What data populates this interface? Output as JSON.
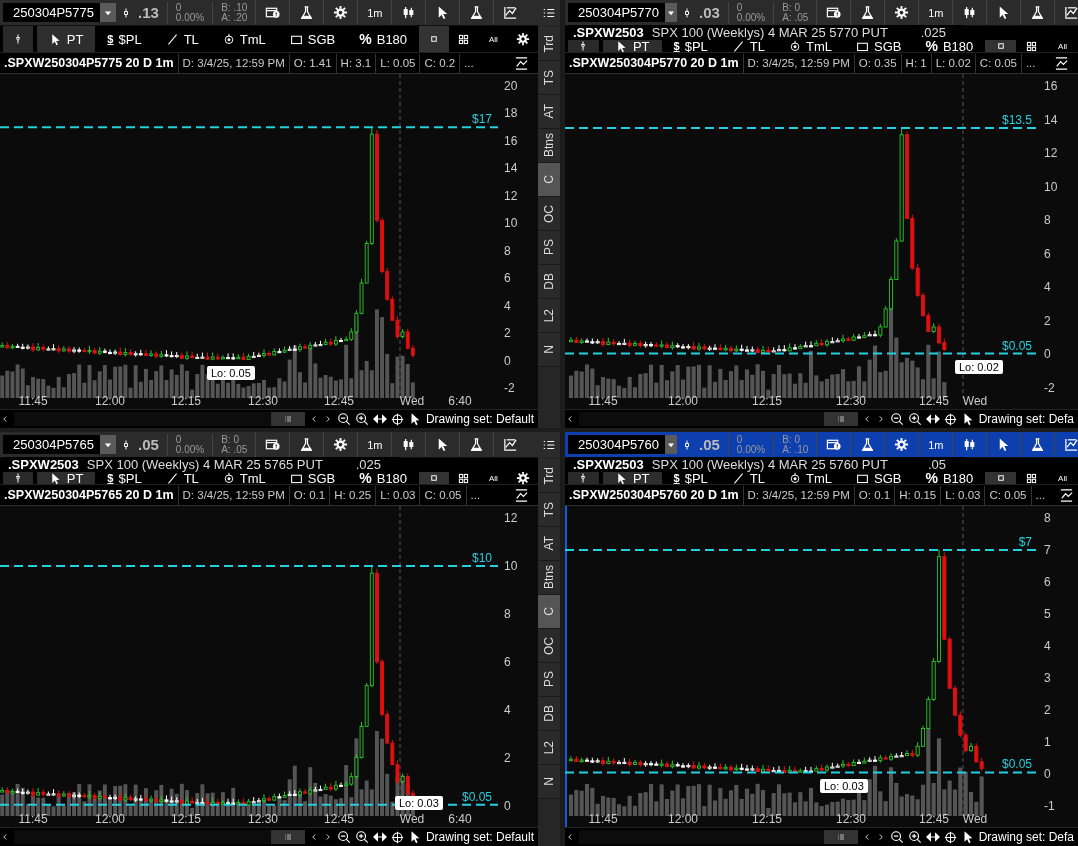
{
  "panels": [
    {
      "active": false,
      "symbol": "250304P5775",
      "last": ".13",
      "change": "0",
      "change_pct": "0.00%",
      "bid": "B: .10",
      "ask": "A: .20",
      "interval": "1m",
      "tools": [
        {
          "kind": "cursor",
          "label": "PT",
          "selected": true
        },
        {
          "kind": "dollar",
          "glyph": "$",
          "label": "$PL",
          "selected": false
        },
        {
          "kind": "line",
          "label": "TL",
          "selected": false
        },
        {
          "kind": "target",
          "label": "TmL",
          "selected": false
        },
        {
          "kind": "rect",
          "label": "SGB",
          "selected": false
        },
        {
          "kind": "percent",
          "glyph": "%",
          "label": "B180",
          "selected": false
        }
      ],
      "views": [
        {
          "kind": "single",
          "selected": true
        },
        {
          "kind": "grid",
          "selected": false
        },
        {
          "kind": "all",
          "label": "All",
          "selected": false
        },
        {
          "kind": "settings",
          "selected": false
        }
      ],
      "info": {
        "title": ".SPXW250304P5775 20 D 1m",
        "fields": [
          "D: 3/4/25, 12:59 PM",
          "O: 1.41",
          "H: 3.1",
          "L: 0.05",
          "C: 0.2",
          "..."
        ]
      },
      "y_ticks": [
        "20",
        "18",
        "16",
        "14",
        "12",
        "10",
        "8",
        "6",
        "4",
        "2",
        "0",
        "-2"
      ],
      "price_lines": [
        {
          "label": "$17"
        }
      ],
      "low_tag": "Lo: 0.05",
      "x_labels": [
        "11:45",
        "12:00",
        "12:15",
        "12:30",
        "12:45",
        "Wed",
        "6:40"
      ],
      "drawing_set": "Drawing set: Default"
    },
    {
      "active": false,
      "symbol": "250304P5770",
      "last": ".03",
      "change": "0",
      "change_pct": "0.00%",
      "bid": "B: 0",
      "ask": "A: .05",
      "interval": "1m",
      "tooltip": {
        "symbol": ".SPXW2503",
        "description": "SPX 100 (Weeklys) 4 MAR 25 5770 PUT",
        "value": ".025"
      },
      "tools": [
        {
          "kind": "cursor",
          "label": "PT",
          "selected": true
        },
        {
          "kind": "dollar",
          "glyph": "$",
          "label": "$PL",
          "selected": false
        },
        {
          "kind": "line",
          "label": "TL",
          "selected": false
        },
        {
          "kind": "target",
          "label": "TmL",
          "selected": false
        },
        {
          "kind": "rect",
          "label": "SGB",
          "selected": false
        },
        {
          "kind": "percent",
          "glyph": "%",
          "label": "B180",
          "selected": false
        }
      ],
      "views": [
        {
          "kind": "single",
          "selected": true
        },
        {
          "kind": "grid",
          "selected": false
        },
        {
          "kind": "all",
          "label": "All",
          "selected": false
        }
      ],
      "info": {
        "title": ".SPXW250304P5770 20 D 1m",
        "fields": [
          "D: 3/4/25, 12:59 PM",
          "O: 0.35",
          "H: 1",
          "L: 0.02",
          "C: 0.05",
          "..."
        ]
      },
      "y_ticks": [
        "16",
        "14",
        "12",
        "10",
        "8",
        "6",
        "4",
        "2",
        "0",
        "-2"
      ],
      "price_lines": [
        {
          "label": "$13.5"
        },
        {
          "label": "$0.05"
        }
      ],
      "low_tag": "Lo: 0.02",
      "x_labels": [
        "11:45",
        "12:00",
        "12:15",
        "12:30",
        "12:45",
        "Wed"
      ],
      "drawing_set": "Drawing set: Defa"
    },
    {
      "active": false,
      "symbol": "250304P5765",
      "last": ".05",
      "change": "0",
      "change_pct": "0.00%",
      "bid": "B: 0",
      "ask": "A: .05",
      "interval": "1m",
      "tooltip": {
        "symbol": ".SPXW2503",
        "description": "SPX 100 (Weeklys) 4 MAR 25 5765 PUT",
        "value": ".025"
      },
      "tools": [
        {
          "kind": "cursor",
          "label": "PT",
          "selected": true
        },
        {
          "kind": "dollar",
          "glyph": "$",
          "label": "$PL",
          "selected": false
        },
        {
          "kind": "line",
          "label": "TL",
          "selected": false
        },
        {
          "kind": "target",
          "label": "TmL",
          "selected": false
        },
        {
          "kind": "rect",
          "label": "SGB",
          "selected": false
        },
        {
          "kind": "percent",
          "glyph": "%",
          "label": "B180",
          "selected": false
        }
      ],
      "views": [
        {
          "kind": "single",
          "selected": true
        },
        {
          "kind": "grid",
          "selected": false
        },
        {
          "kind": "all",
          "label": "All",
          "selected": false
        },
        {
          "kind": "settings",
          "selected": false
        }
      ],
      "info": {
        "title": ".SPXW250304P5765 20 D 1m",
        "fields": [
          "D: 3/4/25, 12:59 PM",
          "O: 0.1",
          "H: 0.25",
          "L: 0.03",
          "C: 0.05",
          "..."
        ]
      },
      "y_ticks": [
        "12",
        "10",
        "8",
        "6",
        "4",
        "2",
        "0"
      ],
      "price_lines": [
        {
          "label": "$10"
        },
        {
          "label": "$0.05"
        }
      ],
      "low_tag": "Lo: 0.03",
      "x_labels": [
        "11:45",
        "12:00",
        "12:15",
        "12:30",
        "12:45",
        "Wed",
        "6:40"
      ],
      "drawing_set": "Drawing set: Default"
    },
    {
      "active": true,
      "symbol": "250304P5760",
      "last": ".05",
      "change": "0",
      "change_pct": "0.00%",
      "bid": "B: 0",
      "ask": "A: .10",
      "interval": "1m",
      "tooltip": {
        "symbol": ".SPXW2503",
        "description": "SPX 100 (Weeklys) 4 MAR 25 5760 PUT",
        "value": ".05"
      },
      "tools": [
        {
          "kind": "cursor",
          "label": "PT",
          "selected": true
        },
        {
          "kind": "dollar",
          "glyph": "$",
          "label": "$PL",
          "selected": false
        },
        {
          "kind": "line",
          "label": "TL",
          "selected": false
        },
        {
          "kind": "target",
          "label": "TmL",
          "selected": false
        },
        {
          "kind": "rect",
          "label": "SGB",
          "selected": false
        },
        {
          "kind": "percent",
          "glyph": "%",
          "label": "B180",
          "selected": false
        }
      ],
      "views": [
        {
          "kind": "single",
          "selected": true
        },
        {
          "kind": "grid",
          "selected": false
        },
        {
          "kind": "all",
          "label": "All",
          "selected": false
        }
      ],
      "info": {
        "title": ".SPXW250304P5760 20 D 1m",
        "fields": [
          "D: 3/4/25, 12:59 PM",
          "O: 0.1",
          "H: 0.15",
          "L: 0.03",
          "C: 0.05",
          "..."
        ]
      },
      "y_ticks": [
        "8",
        "7",
        "6",
        "5",
        "4",
        "3",
        "2",
        "1",
        "0",
        "-1"
      ],
      "price_lines": [
        {
          "label": "$7"
        },
        {
          "label": "$0.05"
        }
      ],
      "low_tag": "Lo: 0.03",
      "x_labels": [
        "11:45",
        "12:00",
        "12:15",
        "12:30",
        "12:45",
        "Wed"
      ],
      "drawing_set": "Drawing set: Defa"
    }
  ],
  "sidebars": [
    {
      "tabs": [
        {
          "label": "Trd",
          "selected": false
        },
        {
          "label": "TS",
          "selected": false
        },
        {
          "label": "AT",
          "selected": false
        },
        {
          "label": "Btns",
          "selected": false
        },
        {
          "label": "C",
          "selected": true
        },
        {
          "label": "OC",
          "selected": false
        },
        {
          "label": "PS",
          "selected": false
        },
        {
          "label": "DB",
          "selected": false
        },
        {
          "label": "L2",
          "selected": false
        },
        {
          "label": "N",
          "selected": false
        }
      ]
    },
    {
      "tabs": [
        {
          "label": "Trd",
          "selected": false
        },
        {
          "label": "TS",
          "selected": false
        },
        {
          "label": "AT",
          "selected": false
        },
        {
          "label": "Btns",
          "selected": false
        },
        {
          "label": "C",
          "selected": true
        },
        {
          "label": "OC",
          "selected": false
        },
        {
          "label": "PS",
          "selected": false
        },
        {
          "label": "DB",
          "selected": false
        },
        {
          "label": "L2",
          "selected": false
        },
        {
          "label": "N",
          "selected": false
        }
      ]
    }
  ]
}
